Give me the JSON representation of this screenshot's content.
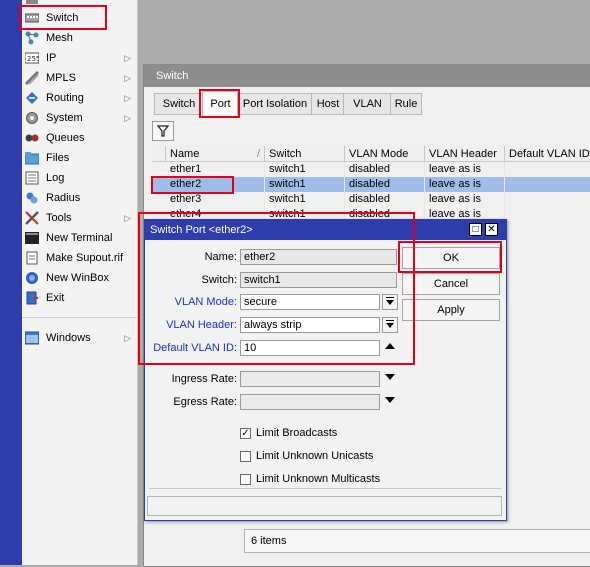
{
  "sidebar": {
    "items": [
      {
        "label": "Switch",
        "icon": "switch-icon",
        "arrow": false
      },
      {
        "label": "Mesh",
        "icon": "mesh-icon",
        "arrow": false
      },
      {
        "label": "IP",
        "icon": "ip-icon",
        "arrow": true
      },
      {
        "label": "MPLS",
        "icon": "mpls-icon",
        "arrow": true
      },
      {
        "label": "Routing",
        "icon": "routing-icon",
        "arrow": true
      },
      {
        "label": "System",
        "icon": "system-icon",
        "arrow": true
      },
      {
        "label": "Queues",
        "icon": "queues-icon",
        "arrow": false
      },
      {
        "label": "Files",
        "icon": "files-icon",
        "arrow": false
      },
      {
        "label": "Log",
        "icon": "log-icon",
        "arrow": false
      },
      {
        "label": "Radius",
        "icon": "radius-icon",
        "arrow": false
      },
      {
        "label": "Tools",
        "icon": "tools-icon",
        "arrow": true
      },
      {
        "label": "New Terminal",
        "icon": "terminal-icon",
        "arrow": false
      },
      {
        "label": "Make Supout.rif",
        "icon": "supout-icon",
        "arrow": false
      },
      {
        "label": "New WinBox",
        "icon": "winbox-icon",
        "arrow": false
      },
      {
        "label": "Exit",
        "icon": "exit-icon",
        "arrow": false
      },
      {
        "label": "Windows",
        "icon": "windows-icon",
        "arrow": true
      }
    ],
    "arrow_glyph": "▷"
  },
  "switch_window": {
    "title": "Switch",
    "tabs": [
      "Switch",
      "Port",
      "Port Isolation",
      "Host",
      "VLAN",
      "Rule"
    ],
    "active_tab": "Port",
    "columns": [
      "Name",
      "Switch",
      "VLAN Mode",
      "VLAN Header",
      "Default VLAN ID"
    ],
    "sort_glyph": "/",
    "rows": [
      {
        "name": "ether1",
        "switch": "switch1",
        "vlan_mode": "disabled",
        "vlan_header": "leave as is",
        "default_vlan_id": ""
      },
      {
        "name": "ether2",
        "switch": "switch1",
        "vlan_mode": "disabled",
        "vlan_header": "leave as is",
        "default_vlan_id": ""
      },
      {
        "name": "ether3",
        "switch": "switch1",
        "vlan_mode": "disabled",
        "vlan_header": "leave as is",
        "default_vlan_id": ""
      },
      {
        "name": "ether4",
        "switch": "switch1",
        "vlan_mode": "disabled",
        "vlan_header": "leave as is",
        "default_vlan_id": ""
      }
    ],
    "selected_row": "ether2",
    "status": "6 items"
  },
  "dialog": {
    "title": "Switch Port <ether2>",
    "restore_glyph": "□",
    "close_glyph": "✕",
    "fields": {
      "name_label": "Name:",
      "name_value": "ether2",
      "switch_label": "Switch:",
      "switch_value": "switch1",
      "vlan_mode_label": "VLAN Mode:",
      "vlan_mode_value": "secure",
      "vlan_header_label": "VLAN Header:",
      "vlan_header_value": "always strip",
      "default_vlan_label": "Default VLAN ID:",
      "default_vlan_value": "10",
      "ingress_label": "Ingress Rate:",
      "ingress_value": "",
      "egress_label": "Egress Rate:",
      "egress_value": ""
    },
    "buttons": {
      "ok": "OK",
      "cancel": "Cancel",
      "apply": "Apply"
    },
    "checkboxes": [
      {
        "label": "Limit Broadcasts",
        "checked": true
      },
      {
        "label": "Limit Unknown Unicasts",
        "checked": false
      },
      {
        "label": "Limit Unknown Multicasts",
        "checked": false
      }
    ]
  },
  "colors": {
    "highlight": "#e0001c",
    "title_blue": "#2f3cab",
    "label_blue": "#2330c9",
    "selection": "#9fbde8"
  }
}
